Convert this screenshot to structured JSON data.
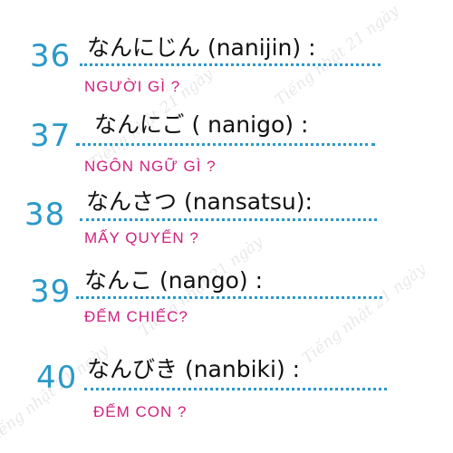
{
  "watermark": "Tiếng nhật 21 ngày",
  "colors": {
    "number": "#2a99c9",
    "dots": "#2a99c9",
    "meaning": "#d0217f",
    "japanese": "#111111"
  },
  "entries": [
    {
      "number": "36",
      "japanese": "なんにじん (nanijin) :",
      "meaning": "NGƯỜI GÌ ?"
    },
    {
      "number": "37",
      "japanese": "なんにご ( nanigo) :",
      "meaning": "NGÔN NGỮ GÌ ?"
    },
    {
      "number": "38",
      "japanese": "なんさつ (nansatsu):",
      "meaning": "MẤY QUYỂN ?"
    },
    {
      "number": "39",
      "japanese": "なんこ  (nango) :",
      "meaning": "ĐẾM CHIẾC?"
    },
    {
      "number": "40",
      "japanese": "なんびき (nanbiki) :",
      "meaning": "ĐẾM CON ?"
    }
  ]
}
